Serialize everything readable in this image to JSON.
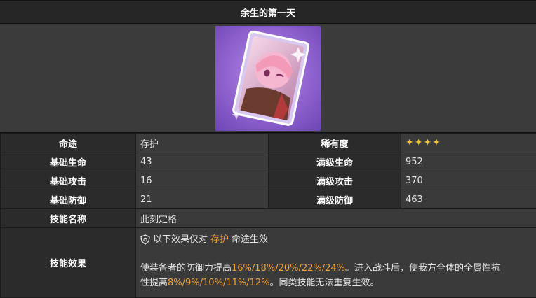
{
  "title": "余生的第一天",
  "portrait_icon": "lightcone-portrait",
  "rows": {
    "path_label": "命途",
    "path_value": "存护",
    "rarity_label": "稀有度",
    "rarity_value": "✦✦✦✦",
    "hp_base_label": "基础生命",
    "hp_base_value": "43",
    "hp_max_label": "满级生命",
    "hp_max_value": "952",
    "atk_base_label": "基础攻击",
    "atk_base_value": "16",
    "atk_max_label": "满级攻击",
    "atk_max_value": "370",
    "def_base_label": "基础防御",
    "def_base_value": "21",
    "def_max_label": "满级防御",
    "def_max_value": "463",
    "skill_name_label": "技能名称",
    "skill_name_value": "此刻定格",
    "skill_effect_label": "技能效果"
  },
  "effect": {
    "note_pre": "以下效果仅对",
    "note_path": "存护",
    "note_post": "命途生效",
    "line1_pre": "使装备者的防御力提高",
    "line1_values": "16%/18%/20%/22%/24%",
    "line1_post": "。进入战斗后，使我方全体的全属性抗",
    "line2_pre": "性提高",
    "line2_values": "8%/9%/10%/11%/12%",
    "line2_post": "。同类技能无法重复生效。"
  },
  "colors": {
    "highlight": "#f0a23a",
    "stars": "#f4c542"
  }
}
